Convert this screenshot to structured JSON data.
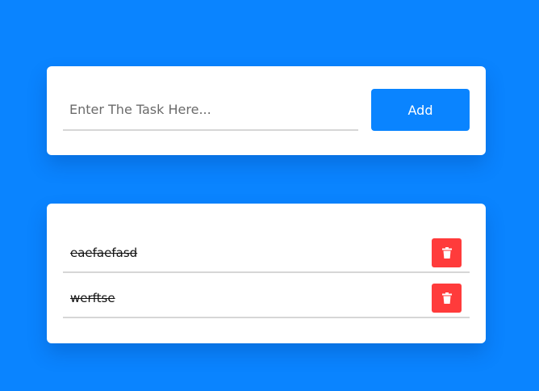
{
  "task_form": {
    "input_placeholder": "Enter The Task Here...",
    "input_value": "",
    "add_label": "Add"
  },
  "tasks": [
    {
      "text": "eaefaefasd",
      "completed": true,
      "delete_icon": "trash-icon"
    },
    {
      "text": "werftse",
      "completed": true,
      "delete_icon": "trash-icon"
    }
  ],
  "colors": {
    "background": "#0a84ff",
    "primary_button": "#0a84ff",
    "delete_button": "#ff3b3b",
    "card": "#ffffff"
  }
}
